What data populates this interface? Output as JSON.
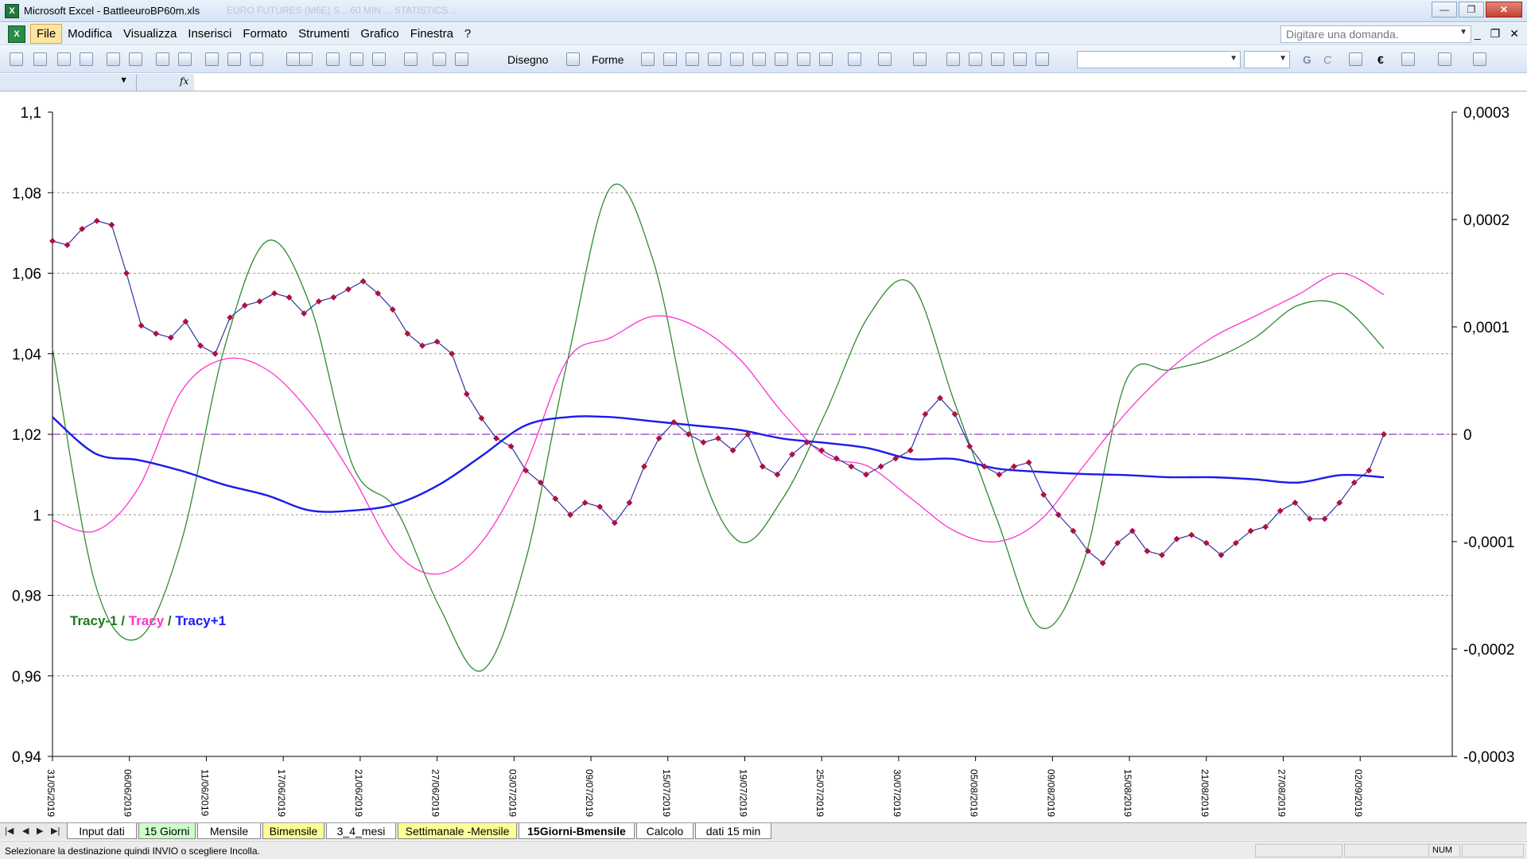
{
  "window": {
    "title": "Microsoft Excel - BattleeuroBP60m.xls",
    "ghost_title": "EURO FUTURES (M6E) S... 60 MIN ... STATISTICS ...",
    "app_icon_glyph": "X",
    "min_label": "—",
    "max_label": "❐",
    "close_label": "✕"
  },
  "menubar": {
    "items": [
      "File",
      "Modifica",
      "Visualizza",
      "Inserisci",
      "Formato",
      "Strumenti",
      "Grafico",
      "Finestra",
      "?"
    ],
    "active_index": 0,
    "help_placeholder": "Digitare una domanda.",
    "doc_min": "_",
    "doc_restore": "❐",
    "doc_close": "✕"
  },
  "toolbar": {
    "disegno_label": "Disegno",
    "forme_label": "Forme",
    "icons": [
      "new-icon",
      "open-icon",
      "save-icon",
      "permission-icon",
      "print-icon",
      "print-preview-icon",
      "spelling-icon",
      "research-icon",
      "cut-icon",
      "copy-icon",
      "paste-icon",
      "undo-icon",
      "redo-icon",
      "chart-wizard-icon",
      "hyperlink-icon",
      "autosum-icon",
      "sort-icon",
      "chart-icon",
      "help-icon"
    ],
    "font_bold_label": "G",
    "font_italic_label": "C",
    "euro_label": "€"
  },
  "chart_data": {
    "type": "line",
    "title": "",
    "xlabel": "",
    "ylabel": "",
    "ylim": [
      0.94,
      1.1
    ],
    "y_ticks": [
      "1,1",
      "1,08",
      "1,06",
      "1,04",
      "1,02",
      "1",
      "0,98",
      "0,96",
      "0,94"
    ],
    "y2lim": [
      -0.0003,
      0.0003
    ],
    "y2_ticks": [
      "0,0003",
      "0,0002",
      "0,0001",
      "0",
      "-0,0001",
      "-0,0002",
      "-0,0003"
    ],
    "x_ticks": [
      "31/05/2019",
      "06/06/2019",
      "11/06/2019",
      "17/06/2019",
      "21/06/2019",
      "27/06/2019",
      "03/07/2019",
      "09/07/2019",
      "15/07/2019",
      "19/07/2019",
      "25/07/2019",
      "30/07/2019",
      "05/08/2019",
      "09/08/2019",
      "15/08/2019",
      "21/08/2019",
      "27/08/2019",
      "02/09/2019"
    ],
    "grid": "horizontal dashed",
    "legend": {
      "position": "left",
      "parts": [
        {
          "text": "Tracy-1",
          "color": "#1a7a1a"
        },
        {
          "text": " / ",
          "color": "#1a7a1a"
        },
        {
          "text": "Tracy",
          "color": "#ff33cc"
        },
        {
          "text": " / ",
          "color": "#1a7a1a"
        },
        {
          "text": "Tracy+1",
          "color": "#1a1aff"
        }
      ]
    },
    "zero_line_color": "#9933cc",
    "series": [
      {
        "name": "Prezzo",
        "axis": "left",
        "color": "#3333aa",
        "marker_color": "#b0103c",
        "x": [
          0,
          1,
          2,
          3,
          4,
          5,
          6,
          7,
          8,
          9,
          10,
          11,
          12,
          13,
          14,
          15,
          16,
          17,
          18,
          19,
          20,
          21,
          22,
          23,
          24,
          25,
          26,
          27,
          28,
          29,
          30,
          31,
          32,
          33,
          34,
          35,
          36,
          37,
          38,
          39,
          40,
          41,
          42,
          43,
          44,
          45,
          46,
          47,
          48,
          49,
          50,
          51,
          52,
          53,
          54,
          55,
          56,
          57,
          58,
          59,
          60,
          61,
          62,
          63,
          64,
          65,
          66,
          67,
          68,
          69,
          70,
          71,
          72,
          73,
          74,
          75,
          76,
          77,
          78,
          79,
          80,
          81,
          82,
          83,
          84,
          85,
          86,
          87,
          88,
          89,
          90
        ],
        "values": [
          1.068,
          1.067,
          1.071,
          1.073,
          1.072,
          1.06,
          1.047,
          1.045,
          1.044,
          1.048,
          1.042,
          1.04,
          1.049,
          1.052,
          1.053,
          1.055,
          1.054,
          1.05,
          1.053,
          1.054,
          1.056,
          1.058,
          1.055,
          1.051,
          1.045,
          1.042,
          1.043,
          1.04,
          1.03,
          1.024,
          1.019,
          1.017,
          1.011,
          1.008,
          1.004,
          1.0,
          1.003,
          1.002,
          0.998,
          1.003,
          1.012,
          1.019,
          1.023,
          1.02,
          1.018,
          1.019,
          1.016,
          1.02,
          1.012,
          1.01,
          1.015,
          1.018,
          1.016,
          1.014,
          1.012,
          1.01,
          1.012,
          1.014,
          1.016,
          1.025,
          1.029,
          1.025,
          1.017,
          1.012,
          1.01,
          1.012,
          1.013,
          1.005,
          1.0,
          0.996,
          0.991,
          0.988,
          0.993,
          0.996,
          0.991,
          0.99,
          0.994,
          0.995,
          0.993,
          0.99,
          0.993,
          0.996,
          0.997,
          1.001,
          1.003,
          0.999,
          0.999,
          1.003,
          1.008,
          1.011,
          1.02
        ],
        "x_tick_index": [
          0,
          5.2,
          10.4,
          15.6,
          20.8,
          26,
          31.2,
          36.4,
          41.6,
          46.8,
          52,
          57.2,
          62.4,
          67.6,
          72.8,
          78,
          83.2,
          88.4
        ]
      },
      {
        "name": "Tracy-1",
        "axis": "right",
        "color": "#2e8b2e",
        "values": [
          8e-05,
          -0.00014,
          -0.00019,
          -0.0001,
          8e-05,
          0.00018,
          0.00012,
          -3e-05,
          -7e-05,
          -0.00016,
          -0.00022,
          -0.00012,
          7e-05,
          0.00023,
          0.00016,
          -2e-05,
          -0.0001,
          -6e-05,
          2e-05,
          0.00011,
          0.00014,
          3e-05,
          -8e-05,
          -0.00018,
          -0.00012,
          5e-05,
          6e-05,
          7e-05,
          9e-05,
          0.00012,
          0.00012,
          8e-05
        ]
      },
      {
        "name": "Tracy",
        "axis": "right",
        "color": "#ff33cc",
        "values": [
          -8e-05,
          -9e-05,
          -5e-05,
          4e-05,
          7e-05,
          6e-05,
          2e-05,
          -4e-05,
          -0.00011,
          -0.00013,
          -0.0001,
          -3e-05,
          7e-05,
          9e-05,
          0.00011,
          0.0001,
          7e-05,
          2e-05,
          -2e-05,
          -3e-05,
          -6e-05,
          -9e-05,
          -0.0001,
          -8e-05,
          -3e-05,
          2e-05,
          6e-05,
          9e-05,
          0.00011,
          0.00013,
          0.00015,
          0.00013
        ]
      },
      {
        "name": "Tracy+1",
        "axis": "right",
        "color": "#1a1aee",
        "values": [
          1.6e-05,
          -1.8e-05,
          -2.4e-05,
          -3.4e-05,
          -4.7e-05,
          -5.7e-05,
          -7.1e-05,
          -7.1e-05,
          -6.5e-05,
          -4.7e-05,
          -2e-05,
          8e-06,
          1.6e-05,
          1.6e-05,
          1.2e-05,
          8e-06,
          4e-06,
          -4e-06,
          -8e-06,
          -1.3e-05,
          -2.3e-05,
          -2.3e-05,
          -3.2e-05,
          -3.5e-05,
          -3.7e-05,
          -3.8e-05,
          -4e-05,
          -4e-05,
          -4.2e-05,
          -4.5e-05,
          -3.8e-05,
          -4e-05
        ]
      }
    ]
  },
  "sheet_tabs": [
    {
      "label": "Input dati",
      "bg": "#ffffff",
      "bold": false
    },
    {
      "label": "15 Giorni",
      "bg": "#ccffcc",
      "bold": false
    },
    {
      "label": "Mensile",
      "bg": "#ffffff",
      "bold": false
    },
    {
      "label": "Bimensile",
      "bg": "#ffff99",
      "bold": false
    },
    {
      "label": "3_4_mesi",
      "bg": "#ffffff",
      "bold": false
    },
    {
      "label": "Settimanale -Mensile",
      "bg": "#ffff99",
      "bold": false
    },
    {
      "label": "15Giorni-Bmensile",
      "bg": "#ffffff",
      "bold": true
    },
    {
      "label": "Calcolo",
      "bg": "#ffffff",
      "bold": false
    },
    {
      "label": "dati 15 min",
      "bg": "#ffffff",
      "bold": false
    }
  ],
  "tab_nav": [
    "|◀",
    "◀",
    "▶",
    "▶|"
  ],
  "status": {
    "text": "Selezionare la destinazione quindi INVIO o scegliere Incolla.",
    "num": "NUM"
  }
}
